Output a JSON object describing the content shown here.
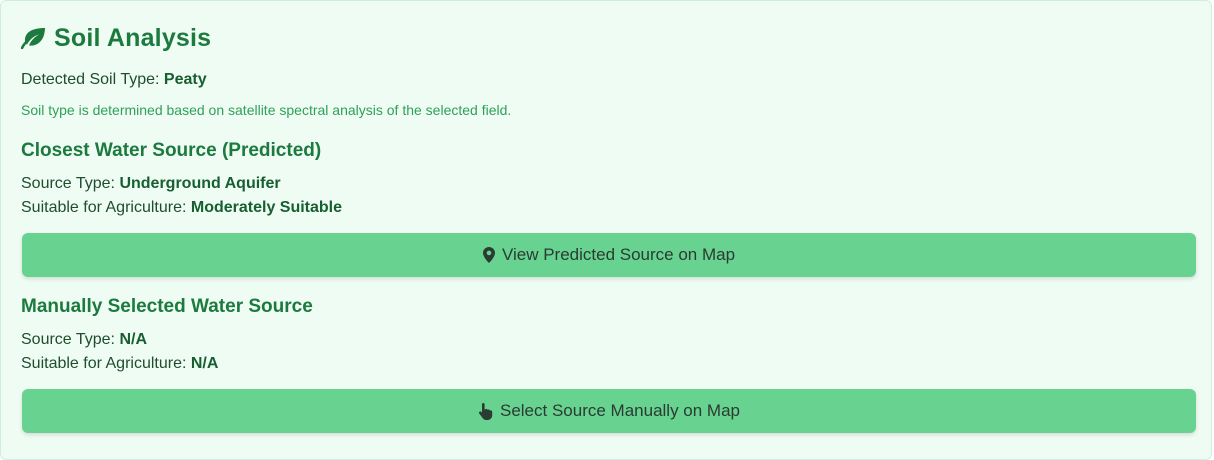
{
  "soil": {
    "title": "Soil Analysis",
    "title_icon": "leaf-icon",
    "detected_label": "Detected Soil Type: ",
    "detected_value": "Peaty",
    "note": "Soil type is determined based on satellite spectral analysis of the selected field."
  },
  "predicted": {
    "heading": "Closest Water Source (Predicted)",
    "source_type_label": "Source Type: ",
    "source_type_value": "Underground Aquifer",
    "suitability_label": "Suitable for Agriculture: ",
    "suitability_value": "Moderately Suitable",
    "button_label": "View Predicted Source on Map",
    "button_icon": "map-pin-icon"
  },
  "manual": {
    "heading": "Manually Selected Water Source",
    "source_type_label": "Source Type: ",
    "source_type_value": "N/A",
    "suitability_label": "Suitable for Agriculture: ",
    "suitability_value": "N/A",
    "button_label": "Select Source Manually on Map",
    "button_icon": "pointer-hand-icon"
  },
  "colors": {
    "card_background": "#effcf3",
    "heading_green": "#1c7a3f",
    "note_green": "#2ea158",
    "button_green": "#68d391"
  }
}
